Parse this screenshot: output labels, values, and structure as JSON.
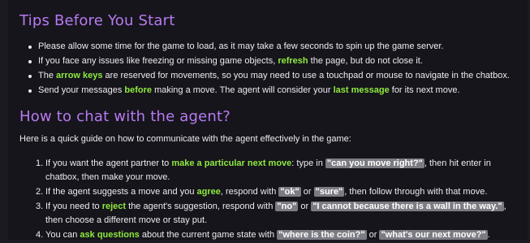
{
  "tips": {
    "heading": "Tips Before You Start",
    "items": [
      {
        "parts": [
          {
            "text": "Please allow some time for the game to load, as it may take a few seconds to spin up the game server.",
            "style": "plain"
          }
        ]
      },
      {
        "parts": [
          {
            "text": "If you face any issues like freezing or missing game objects, ",
            "style": "plain"
          },
          {
            "text": "refresh",
            "style": "highlight"
          },
          {
            "text": " the page, but do not close it.",
            "style": "plain"
          }
        ]
      },
      {
        "parts": [
          {
            "text": "The ",
            "style": "plain"
          },
          {
            "text": "arrow keys",
            "style": "highlight"
          },
          {
            "text": " are reserved for movements, so you may need to use a touchpad or mouse to navigate in the chatbox.",
            "style": "plain"
          }
        ]
      },
      {
        "parts": [
          {
            "text": "Send your messages ",
            "style": "plain"
          },
          {
            "text": "before",
            "style": "highlight"
          },
          {
            "text": " making a move. The agent will consider your ",
            "style": "plain"
          },
          {
            "text": "last message",
            "style": "highlight"
          },
          {
            "text": " for its next move.",
            "style": "plain"
          }
        ]
      }
    ]
  },
  "chat_guide": {
    "heading": "How to chat with the agent?",
    "intro": "Here is a quick guide on how to communicate with the agent effectively in the game:",
    "steps": [
      {
        "number": "1.",
        "parts": [
          {
            "text": "If you want the agent partner to ",
            "style": "plain"
          },
          {
            "text": "make a particular next move",
            "style": "highlight"
          },
          {
            "text": ": type in ",
            "style": "plain"
          },
          {
            "text": "\"can you move right?\"",
            "style": "quote"
          },
          {
            "text": ", then hit enter in chatbox, then make your move.",
            "style": "plain"
          }
        ]
      },
      {
        "number": "2.",
        "parts": [
          {
            "text": "If the agent suggests a move and you ",
            "style": "plain"
          },
          {
            "text": "agree",
            "style": "highlight"
          },
          {
            "text": ", respond with ",
            "style": "plain"
          },
          {
            "text": "\"ok\"",
            "style": "quote"
          },
          {
            "text": " or ",
            "style": "plain"
          },
          {
            "text": "\"sure\"",
            "style": "quote"
          },
          {
            "text": ", then follow through with that move.",
            "style": "plain"
          }
        ]
      },
      {
        "number": "3.",
        "parts": [
          {
            "text": "If you need to ",
            "style": "plain"
          },
          {
            "text": "reject",
            "style": "highlight"
          },
          {
            "text": " the agent's suggestion, respond with ",
            "style": "plain"
          },
          {
            "text": "\"no\"",
            "style": "quote"
          },
          {
            "text": " or ",
            "style": "plain"
          },
          {
            "text": "\"I cannot because there is a wall in the way.\"",
            "style": "quote"
          },
          {
            "text": ", then choose a different move or stay put.",
            "style": "plain"
          }
        ]
      },
      {
        "number": "4.",
        "parts": [
          {
            "text": "You can ",
            "style": "plain"
          },
          {
            "text": "ask questions",
            "style": "highlight"
          },
          {
            "text": " about the current game state with ",
            "style": "plain"
          },
          {
            "text": "\"where is the coin?\"",
            "style": "quote"
          },
          {
            "text": " or ",
            "style": "plain"
          },
          {
            "text": "\"what's our next move?\"",
            "style": "quote"
          },
          {
            "text": ".",
            "style": "plain"
          }
        ]
      }
    ]
  },
  "colors": {
    "heading": "#b77af0",
    "highlight": "#8eea3e",
    "quote_bg": "#7b7b83",
    "background": "#16151c"
  }
}
